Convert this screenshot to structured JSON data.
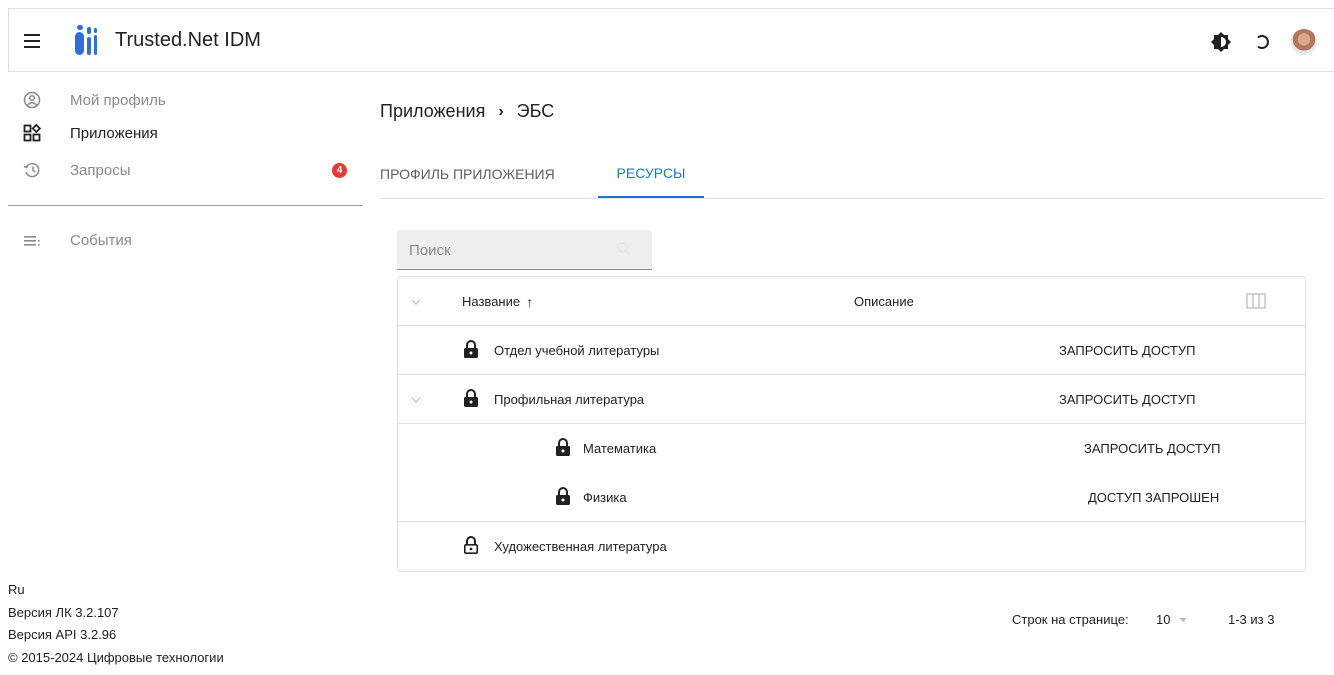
{
  "app": {
    "title": "Trusted.Net IDM"
  },
  "sidebar": {
    "items": [
      {
        "label": "Мой профиль",
        "icon": "account-circle-icon",
        "state": "muted"
      },
      {
        "label": "Приложения",
        "icon": "apps-icon",
        "state": "active"
      },
      {
        "label": "Запросы",
        "icon": "history-icon",
        "state": "muted",
        "badge": "4"
      },
      {
        "label": "События",
        "icon": "list-icon",
        "state": "muted"
      }
    ],
    "footer": {
      "lang": "Ru",
      "lk_version": "Версия ЛК 3.2.107",
      "api_version": "Версия API 3.2.96",
      "copyright": "© 2015-2024 Цифровые технологии"
    }
  },
  "breadcrumb": {
    "root": "Приложения",
    "separator": "›",
    "current": "ЭБС"
  },
  "tabs": [
    {
      "label": "Профиль приложения",
      "active": false
    },
    {
      "label": "Ресурсы",
      "active": true
    }
  ],
  "search": {
    "placeholder": "Поиск"
  },
  "table": {
    "columns": {
      "name": "Название",
      "name_sort": "↑",
      "description": "Описание"
    },
    "rows": [
      {
        "name": "Отдел учебной литературы",
        "action": "Запросить доступ",
        "locked": true
      },
      {
        "name": "Профильная литература",
        "action": "Запросить доступ",
        "locked": true,
        "expanded": true
      },
      {
        "name": "Математика",
        "action": "Запросить доступ",
        "locked": true
      },
      {
        "name": "Физика",
        "action": "Доступ запрошен",
        "locked": true
      },
      {
        "name": "Художественная литература",
        "action": "",
        "locked": false
      }
    ]
  },
  "pagination": {
    "rows_label": "Строк на странице:",
    "rows_value": "10",
    "range": "1-3 из 3"
  },
  "colors": {
    "accent": "#1976d2",
    "badge": "#e53935",
    "logo": "#2f6fd6"
  }
}
